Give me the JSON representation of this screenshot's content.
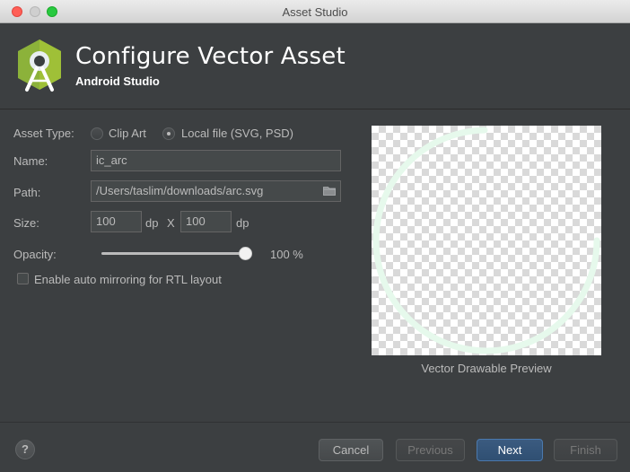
{
  "window": {
    "title": "Asset Studio"
  },
  "header": {
    "title": "Configure Vector Asset",
    "subtitle": "Android Studio"
  },
  "form": {
    "asset_type_label": "Asset Type:",
    "asset_type_options": [
      {
        "label": "Clip Art",
        "checked": false
      },
      {
        "label": "Local file (SVG, PSD)",
        "checked": true
      }
    ],
    "name_label": "Name:",
    "name_value": "ic_arc",
    "path_label": "Path:",
    "path_value": "/Users/taslim/downloads/arc.svg",
    "size_label": "Size:",
    "size_width": "100",
    "size_height": "100",
    "size_unit": "dp",
    "size_separator": "X",
    "opacity_label": "Opacity:",
    "opacity_value": "100 %",
    "opacity_fraction": 1.0,
    "rtl_label": "Enable auto mirroring for RTL layout",
    "rtl_checked": false
  },
  "preview": {
    "caption": "Vector Drawable Preview",
    "arc_color": "#e6f9ec"
  },
  "footer": {
    "help_label": "?",
    "cancel_label": "Cancel",
    "previous_label": "Previous",
    "next_label": "Next",
    "finish_label": "Finish"
  },
  "colors": {
    "background": "#3c3f41",
    "primary_button": "#2f4f72",
    "android_green": "#9fc037"
  }
}
